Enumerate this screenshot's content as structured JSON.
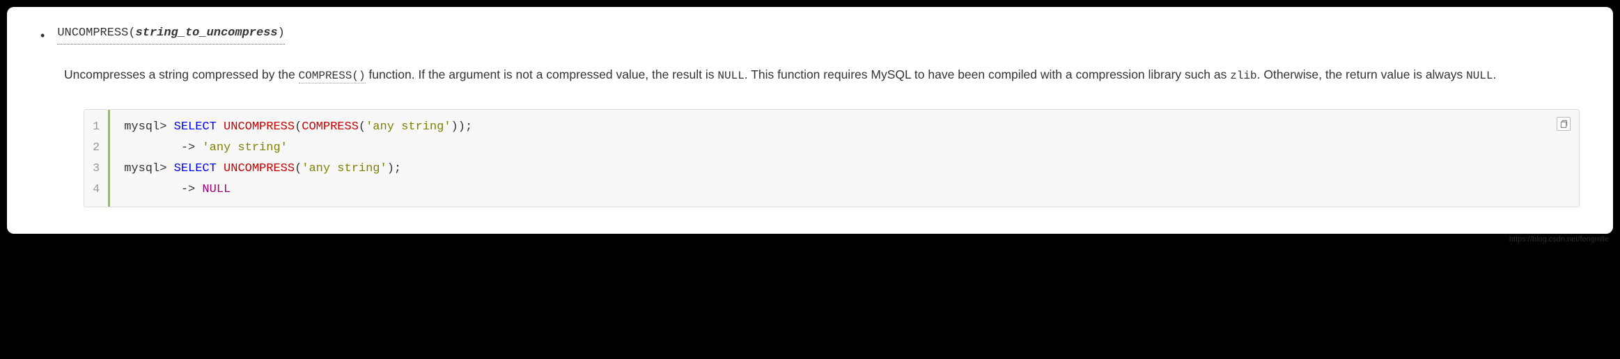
{
  "item": {
    "func_name": "UNCOMPRESS",
    "func_arg": "string_to_uncompress",
    "paren_open": "(",
    "paren_close": ")"
  },
  "desc": {
    "p1": "Uncompresses a string compressed by the ",
    "code1": "COMPRESS()",
    "p2": " function. If the argument is not a compressed value, the result is ",
    "code2": "NULL",
    "p3": ". This function requires MySQL to have been compiled with a compression library such as ",
    "code3": "zlib",
    "p4": ". Otherwise, the return value is always ",
    "code4": "NULL",
    "p5": "."
  },
  "code": {
    "line_numbers": [
      "1",
      "2",
      "3",
      "4"
    ],
    "lines": [
      {
        "tokens": [
          {
            "t": "mysql> ",
            "c": "tok-prompt"
          },
          {
            "t": "SELECT ",
            "c": "tok-kw"
          },
          {
            "t": "UNCOMPRESS",
            "c": "tok-func"
          },
          {
            "t": "(",
            "c": "tok-paren"
          },
          {
            "t": "COMPRESS",
            "c": "tok-func"
          },
          {
            "t": "(",
            "c": "tok-paren"
          },
          {
            "t": "'any string'",
            "c": "tok-str"
          },
          {
            "t": "))",
            "c": "tok-paren"
          },
          {
            "t": ";",
            "c": "tok-punct"
          }
        ]
      },
      {
        "tokens": [
          {
            "t": "        -> ",
            "c": "tok-arrow"
          },
          {
            "t": "'any string'",
            "c": "tok-result"
          }
        ]
      },
      {
        "tokens": [
          {
            "t": "mysql> ",
            "c": "tok-prompt"
          },
          {
            "t": "SELECT ",
            "c": "tok-kw"
          },
          {
            "t": "UNCOMPRESS",
            "c": "tok-func"
          },
          {
            "t": "(",
            "c": "tok-paren"
          },
          {
            "t": "'any string'",
            "c": "tok-str"
          },
          {
            "t": ")",
            "c": "tok-paren"
          },
          {
            "t": ";",
            "c": "tok-punct"
          }
        ]
      },
      {
        "tokens": [
          {
            "t": "        -> ",
            "c": "tok-arrow"
          },
          {
            "t": "NULL",
            "c": "tok-null"
          }
        ]
      }
    ]
  },
  "watermark": "https://blog.csdn.net/fengmlle"
}
